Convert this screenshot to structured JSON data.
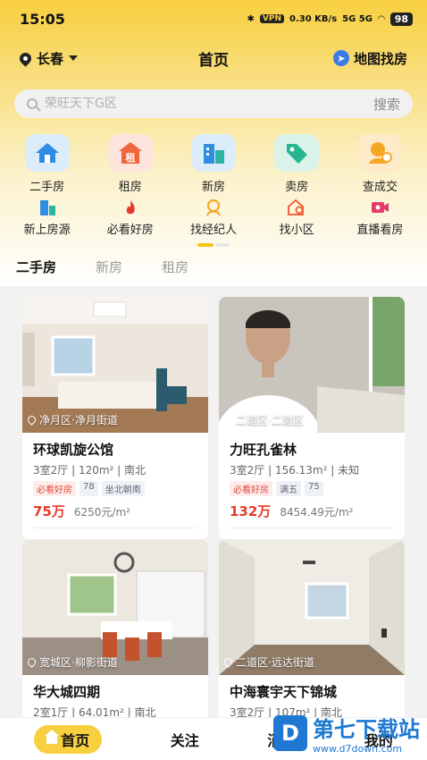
{
  "status": {
    "time": "15:05",
    "vpn": "VPN",
    "speed": "0.30 KB/s",
    "net": "5G 5G",
    "battery": "98"
  },
  "header": {
    "city": "长春",
    "title": "首页",
    "map": "地图找房"
  },
  "search": {
    "placeholder": "荣旺天下G区",
    "button": "搜索"
  },
  "grid1": [
    {
      "label": "二手房",
      "icon": "house-icon",
      "color": "#2f8de4"
    },
    {
      "label": "租房",
      "icon": "rent-icon",
      "color": "#f0653b"
    },
    {
      "label": "新房",
      "icon": "building-icon",
      "color": "#2d8ee0"
    },
    {
      "label": "卖房",
      "icon": "tag-icon",
      "color": "#27b58f"
    },
    {
      "label": "查成交",
      "icon": "coin-person-icon",
      "color": "#f5a623"
    }
  ],
  "grid2": [
    {
      "label": "新上房源",
      "icon": "new-building-icon",
      "color": "#2f8de4"
    },
    {
      "label": "必看好房",
      "icon": "fire-icon",
      "color": "#e53a2b"
    },
    {
      "label": "找经纪人",
      "icon": "agent-icon",
      "color": "#f5a623"
    },
    {
      "label": "找小区",
      "icon": "community-search-icon",
      "color": "#f0653b"
    },
    {
      "label": "直播看房",
      "icon": "live-camera-icon",
      "color": "#e53a6b"
    }
  ],
  "tabs": [
    "二手房",
    "新房",
    "租房"
  ],
  "cards": [
    {
      "location": "净月区·净月街道",
      "name": "环球凯旋公馆",
      "spec": "3室2厅 | 120m² | 南北",
      "tags": [
        "必看好房",
        "78",
        "坐北朝南"
      ],
      "total": "75万",
      "unit": "6250元/m²"
    },
    {
      "location": "二道区·二道区",
      "name": "力旺孔雀林",
      "spec": "3室2厅 | 156.13m² | 未知",
      "tags": [
        "必看好房",
        "满五",
        "75"
      ],
      "total": "132万",
      "unit": "8454.49元/m²"
    },
    {
      "location": "宽城区·柳影街道",
      "name": "华大城四期",
      "spec": "2室1厅 | 64.01m² | 南北"
    },
    {
      "location": "二道区·远达街道",
      "name": "中海寰宇天下锦城",
      "spec": "3室2厅 | 107m² | 南北"
    }
  ],
  "bottom": {
    "home": "首页",
    "follow": "关注",
    "message": "消息",
    "mine": "我的"
  },
  "watermark": {
    "title": "第七下载站",
    "url": "www.d7down.com"
  }
}
